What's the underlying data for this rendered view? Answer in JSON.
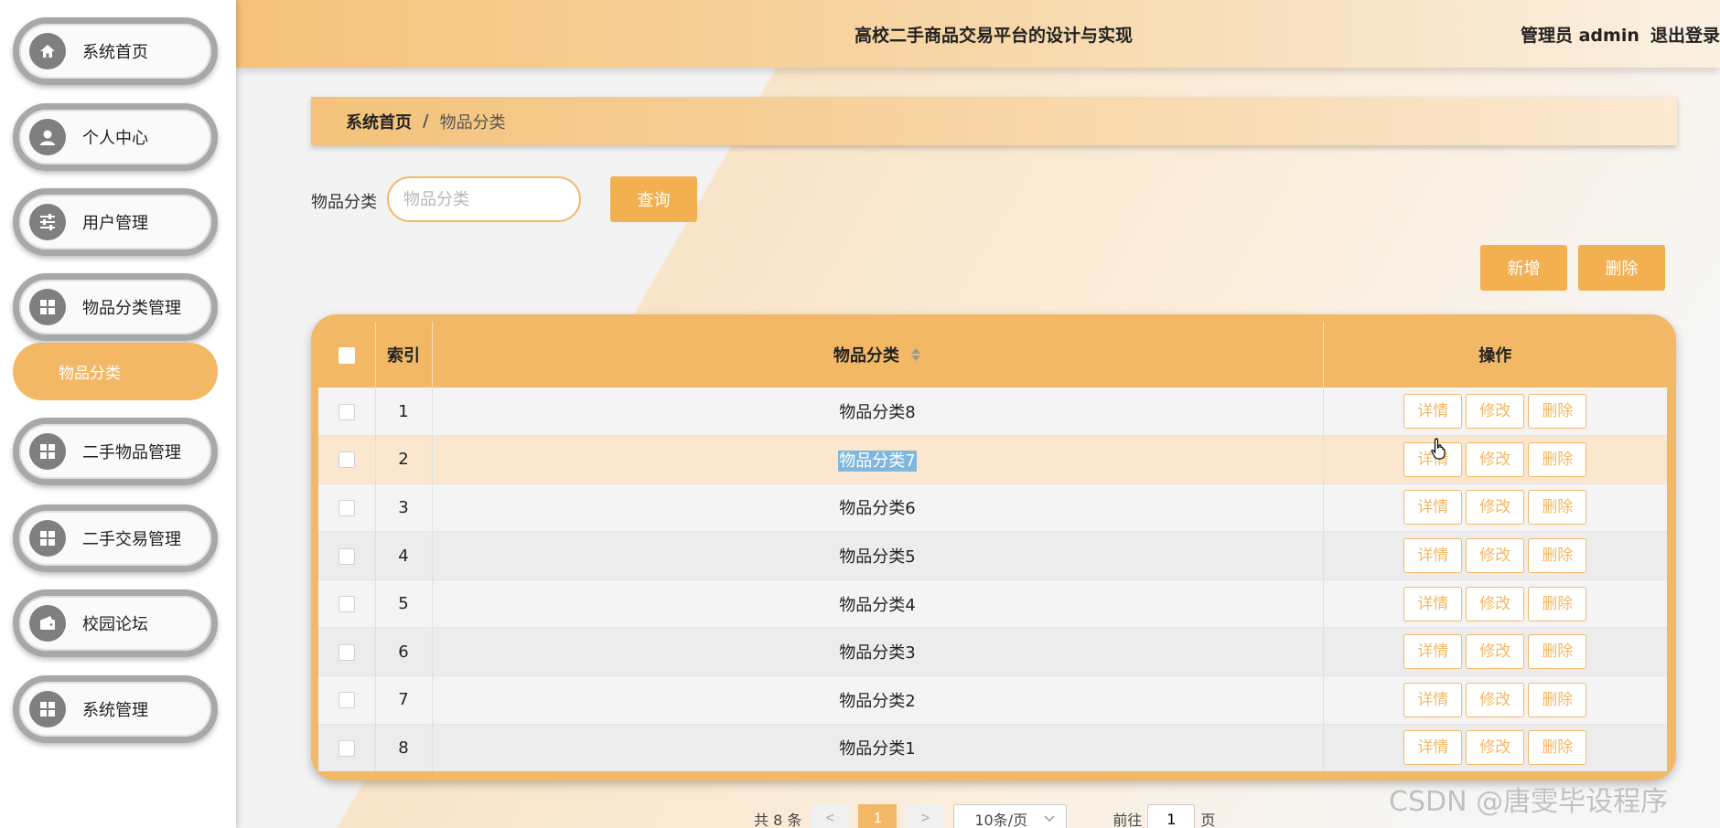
{
  "sidebar": {
    "items": [
      {
        "label": "系统首页",
        "icon": "home-icon"
      },
      {
        "label": "个人中心",
        "icon": "user-icon"
      },
      {
        "label": "用户管理",
        "icon": "sliders-icon"
      },
      {
        "label": "物品分类管理",
        "icon": "grid-icon"
      },
      {
        "label": "物品分类",
        "icon": ""
      },
      {
        "label": "二手物品管理",
        "icon": "grid-icon"
      },
      {
        "label": "二手交易管理",
        "icon": "grid-icon"
      },
      {
        "label": "校园论坛",
        "icon": "wallet-icon"
      },
      {
        "label": "系统管理",
        "icon": "grid-icon"
      }
    ]
  },
  "header": {
    "title": "高校二手商品交易平台的设计与实现",
    "user": "管理员 admin",
    "logout": "退出登录"
  },
  "breadcrumb": {
    "home": "系统首页",
    "separator": "/",
    "current": "物品分类"
  },
  "search": {
    "label": "物品分类",
    "placeholder": "物品分类",
    "query_button": "查询"
  },
  "actions": {
    "add": "新增",
    "delete": "删除"
  },
  "table": {
    "headers": {
      "index": "索引",
      "category": "物品分类",
      "ops": "操作"
    },
    "rows": [
      {
        "index": "1",
        "category": "物品分类8"
      },
      {
        "index": "2",
        "category": "物品分类7"
      },
      {
        "index": "3",
        "category": "物品分类6"
      },
      {
        "index": "4",
        "category": "物品分类5"
      },
      {
        "index": "5",
        "category": "物品分类4"
      },
      {
        "index": "6",
        "category": "物品分类3"
      },
      {
        "index": "7",
        "category": "物品分类2"
      },
      {
        "index": "8",
        "category": "物品分类1"
      }
    ],
    "op_labels": {
      "detail": "详情",
      "edit": "修改",
      "delete": "删除"
    }
  },
  "pager": {
    "total": "共 8 条",
    "prev": "<",
    "current_page": "1",
    "next": ">",
    "page_size": "10条/页",
    "goto_label": "前往",
    "goto_value": "1",
    "page_unit": "页"
  },
  "watermark": "CSDN @唐雯毕设程序",
  "colors": {
    "accent": "#f2b866",
    "button": "#f2b050",
    "selection": "#7fb8dc"
  }
}
